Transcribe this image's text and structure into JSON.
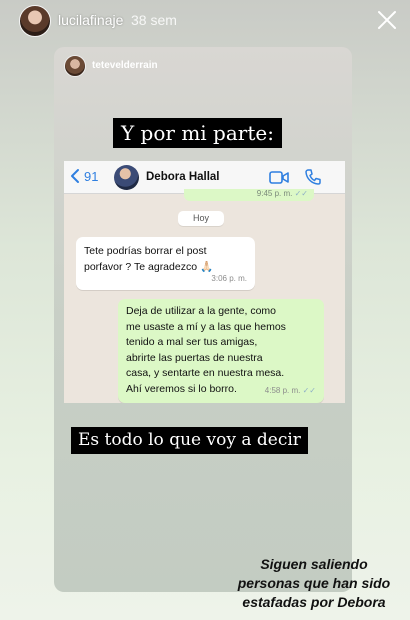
{
  "story": {
    "username": "lucilafinaje",
    "time": "38 sem",
    "close_icon": "close-icon"
  },
  "repost": {
    "username": "tetevelderrain",
    "banner_top": "Y por mi parte:",
    "banner_bottom": "Es todo lo que voy a decir"
  },
  "whatsapp": {
    "back_count": "91",
    "contact_name": "Debora Hallal",
    "prev_time": "9:45 p. m.",
    "day_label": "Hoy",
    "incoming": {
      "line1": "Tete podrías borrar el post",
      "line2": "porfavor ? Te agradezco 🙏🏻",
      "time": "3:06 p. m."
    },
    "outgoing": {
      "line1": "Deja de utilizar a la gente, como",
      "line2": "me usaste a mí y a las que hemos",
      "line3": "tenido a mal ser tus amigas,",
      "line4": "abrirte las puertas de nuestra",
      "line5": "casa, y sentarte en nuestra mesa.",
      "line6": "Ahí veremos si lo borro.",
      "time": "4:58 p. m.",
      "ticks": "✓✓"
    },
    "colors": {
      "accent": "#2f7fe0",
      "outgoing_bubble": "#dcf8c6",
      "chat_bg": "#ece5dd"
    }
  },
  "caption": {
    "line1": "Siguen saliendo",
    "line2": "personas que han sido",
    "line3": "estafadas por Debora"
  }
}
